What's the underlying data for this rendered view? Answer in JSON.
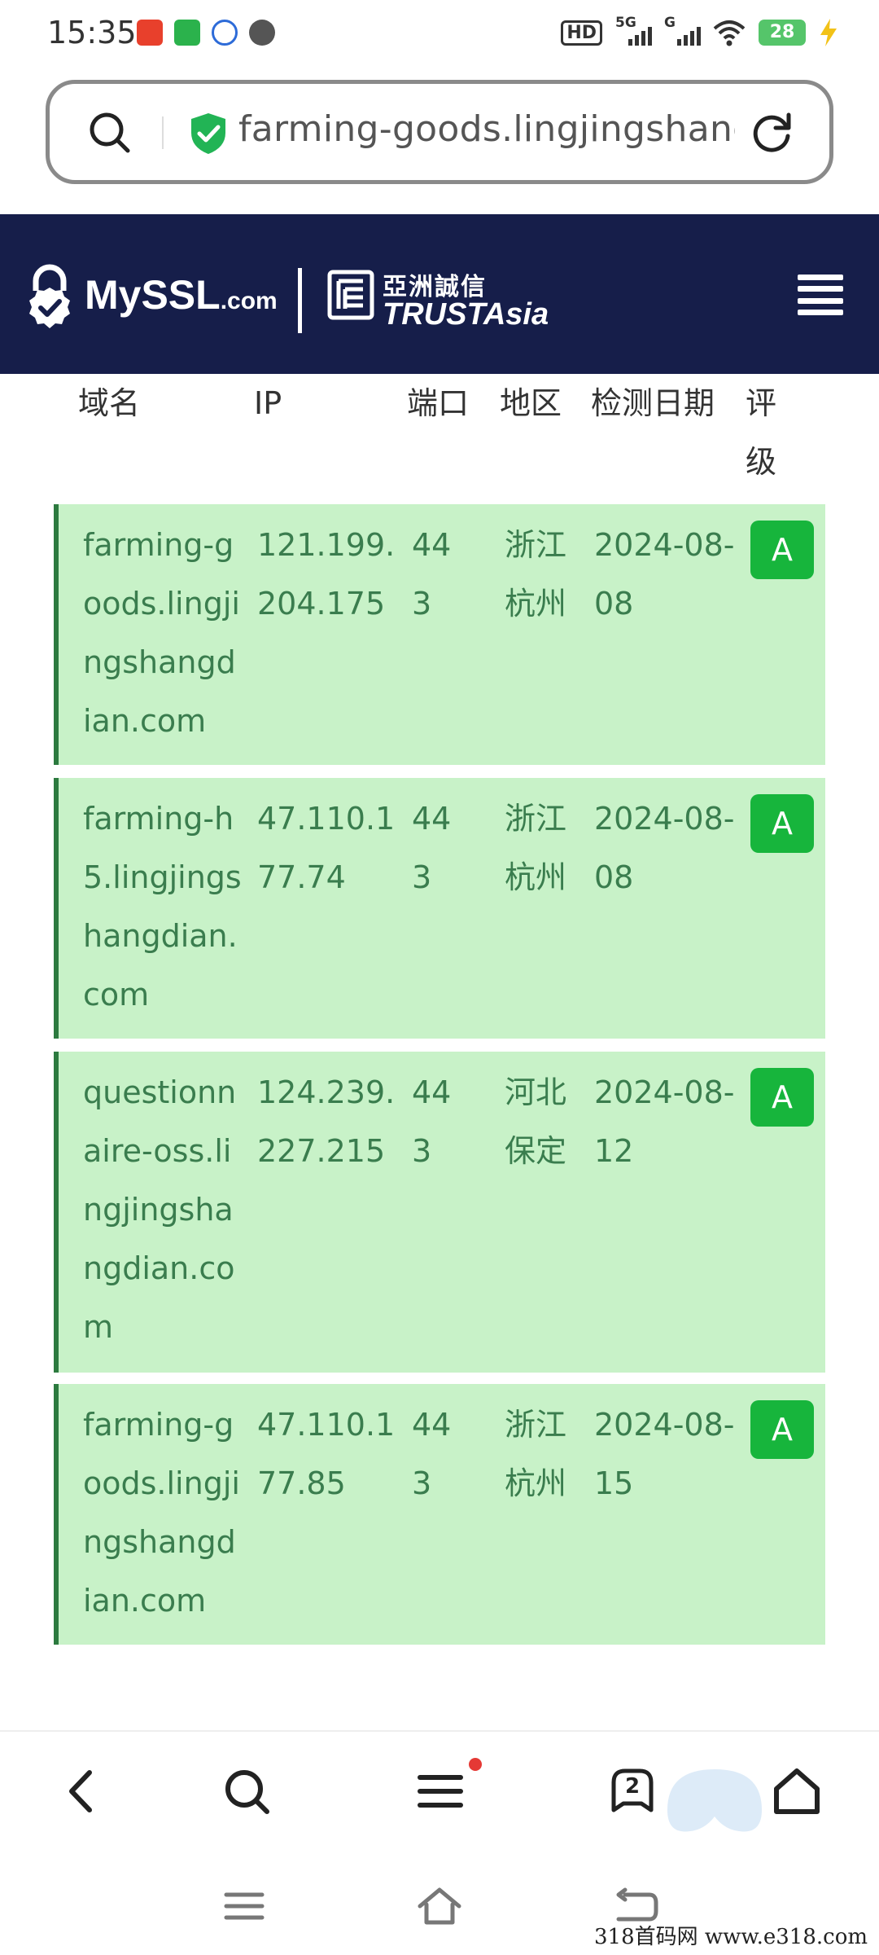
{
  "status_bar": {
    "time": "15:35",
    "hd_badge": "HD",
    "network_5g": "5G",
    "network_g": "G",
    "battery": "28"
  },
  "address_bar": {
    "url": "farming-goods.lingjingshangdian.com"
  },
  "site_header": {
    "myssl_main": "MySSL",
    "myssl_sub": ".com",
    "trustasia_cn": "亞洲誠信",
    "trustasia_en": "TRUSTAsia"
  },
  "table": {
    "headers": {
      "domain": "域名",
      "ip": "IP",
      "port": "端口",
      "region": "地区",
      "date": "检测日期",
      "rating": "评级"
    },
    "rows": [
      {
        "domain": "farming-goods.lingjingshangdian.com",
        "ip": "121.199.204.175",
        "port": "443",
        "region": "浙江杭州",
        "date": "2024-08-08",
        "grade": "A"
      },
      {
        "domain": "farming-h5.lingjingshangdian.com",
        "ip": "47.110.177.74",
        "port": "443",
        "region": "浙江杭州",
        "date": "2024-08-08",
        "grade": "A"
      },
      {
        "domain": "questionnaire-oss.lingjingshangdian.com",
        "ip": "124.239.227.215",
        "port": "443",
        "region": "河北保定",
        "date": "2024-08-12",
        "grade": "A"
      },
      {
        "domain": "farming-goods.lingjingshangdian.com",
        "ip": "47.110.177.85",
        "port": "443",
        "region": "浙江杭州",
        "date": "2024-08-15",
        "grade": "A"
      }
    ]
  },
  "toolbar": {
    "tab_count": "2"
  },
  "watermark": "318首码网 www.e318.com",
  "colors": {
    "header_bg": "#161e4a",
    "row_bg": "#c8f2c8",
    "row_text": "#3a7d4e",
    "grade_bg": "#17b53c",
    "shield": "#22b455"
  }
}
